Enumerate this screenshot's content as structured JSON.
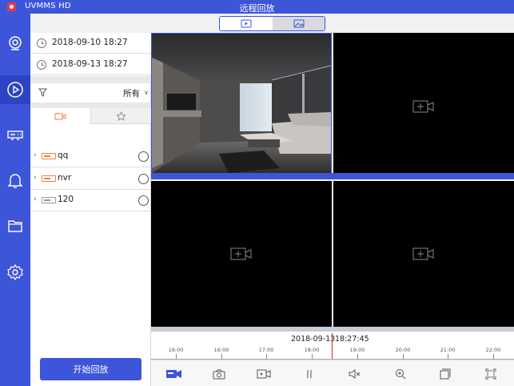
{
  "app": {
    "name": "UVMMS HD",
    "title": "远程回放"
  },
  "colors": {
    "accent": "#3d55d8",
    "cursor": "#e02020",
    "device": "#f08040"
  },
  "nav": [
    {
      "icon": "camera-icon",
      "active": false
    },
    {
      "icon": "playback-icon",
      "active": true
    },
    {
      "icon": "dvr-icon",
      "active": false
    },
    {
      "icon": "bell-icon",
      "active": false
    },
    {
      "icon": "folder-icon",
      "active": false
    },
    {
      "icon": "gear-icon",
      "active": false
    }
  ],
  "panel": {
    "start_time": "2018-09-10 18:27",
    "end_time": "2018-09-13 18:27",
    "filter_value": "所有",
    "devices": [
      {
        "name": "qq",
        "icon": "dvr-device-icon"
      },
      {
        "name": "nvr",
        "icon": "dvr-device-icon"
      },
      {
        "name": "120",
        "icon": "dvr-device-icon"
      }
    ],
    "start_button": "开始回放"
  },
  "view_toggle": {
    "selected": "video"
  },
  "timeline": {
    "date": "2018-09-13",
    "time": "18:27:45",
    "ticks": [
      "16:00",
      "16:00",
      "17:00",
      "18:00",
      "19:00",
      "20:00",
      "21:00",
      "22:00"
    ]
  },
  "toolbar": [
    "record-icon",
    "snapshot-icon",
    "video-clip-icon",
    "pause-icon",
    "mute-icon",
    "zoom-in-icon",
    "split-screen-icon",
    "fullscreen-icon"
  ]
}
